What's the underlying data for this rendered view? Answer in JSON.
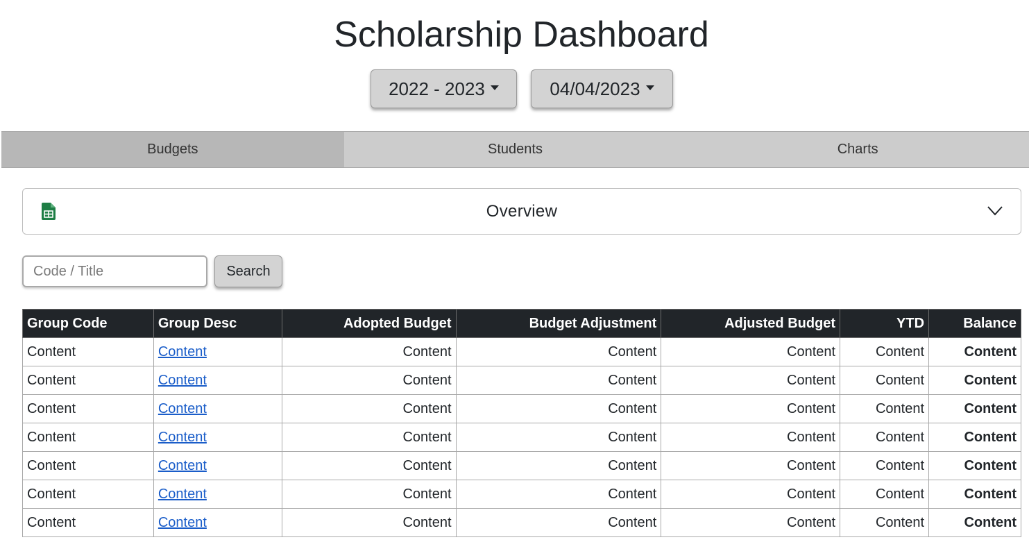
{
  "page": {
    "title": "Scholarship Dashboard"
  },
  "filters": {
    "year_selected": "2022 - 2023",
    "date_selected": "04/04/2023"
  },
  "tabs": [
    {
      "label": "Budgets",
      "active": true
    },
    {
      "label": "Students",
      "active": false
    },
    {
      "label": "Charts",
      "active": false
    }
  ],
  "overview": {
    "title": "Overview",
    "icon": "spreadsheet-icon",
    "toggle_icon": "chevron-down-icon",
    "icon_color": "#1e7e45"
  },
  "search": {
    "placeholder": "Code / Title",
    "value": "",
    "button_label": "Search"
  },
  "table": {
    "headers": [
      "Group Code",
      "Group Desc",
      "Adopted Budget",
      "Budget Adjustment",
      "Adjusted Budget",
      "YTD",
      "Balance"
    ],
    "rows": [
      [
        "Content",
        "Content",
        "Content",
        "Content",
        "Content",
        "Content",
        "Content"
      ],
      [
        "Content",
        "Content",
        "Content",
        "Content",
        "Content",
        "Content",
        "Content"
      ],
      [
        "Content",
        "Content",
        "Content",
        "Content",
        "Content",
        "Content",
        "Content"
      ],
      [
        "Content",
        "Content",
        "Content",
        "Content",
        "Content",
        "Content",
        "Content"
      ],
      [
        "Content",
        "Content",
        "Content",
        "Content",
        "Content",
        "Content",
        "Content"
      ],
      [
        "Content",
        "Content",
        "Content",
        "Content",
        "Content",
        "Content",
        "Content"
      ],
      [
        "Content",
        "Content",
        "Content",
        "Content",
        "Content",
        "Content",
        "Content"
      ]
    ]
  },
  "colors": {
    "header_bg": "#212529",
    "link": "#1a5dc9",
    "balance": "#217a4b",
    "tab_bar": "#cccccc",
    "tab_active": "#b7b7b7"
  }
}
